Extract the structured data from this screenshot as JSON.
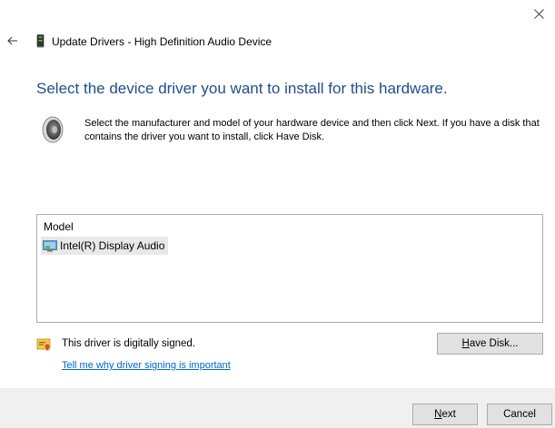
{
  "window": {
    "title": "Update Drivers - High Definition Audio Device"
  },
  "heading": "Select the device driver you want to install for this hardware.",
  "description": "Select the manufacturer and model of your hardware device and then click Next. If you have a disk that contains the driver you want to install, click Have Disk.",
  "model_list": {
    "header": "Model",
    "items": [
      {
        "label": "Intel(R) Display Audio",
        "selected": true
      }
    ]
  },
  "signing": {
    "status": "This driver is digitally signed.",
    "link": "Tell me why driver signing is important"
  },
  "buttons": {
    "have_disk_mnemonic": "H",
    "have_disk_rest": "ave Disk...",
    "next_mnemonic": "N",
    "next_rest": "ext",
    "cancel": "Cancel"
  },
  "colors": {
    "heading": "#1f4e8c",
    "link": "#0066cc",
    "footer": "#f0f0f0",
    "selected_item": "#e8e8e8"
  },
  "icons": {
    "close": "close-icon",
    "back": "back-arrow-icon",
    "device": "audio-device-icon",
    "speaker": "speaker-icon",
    "item": "display-audio-icon",
    "signed": "digital-signature-icon"
  }
}
